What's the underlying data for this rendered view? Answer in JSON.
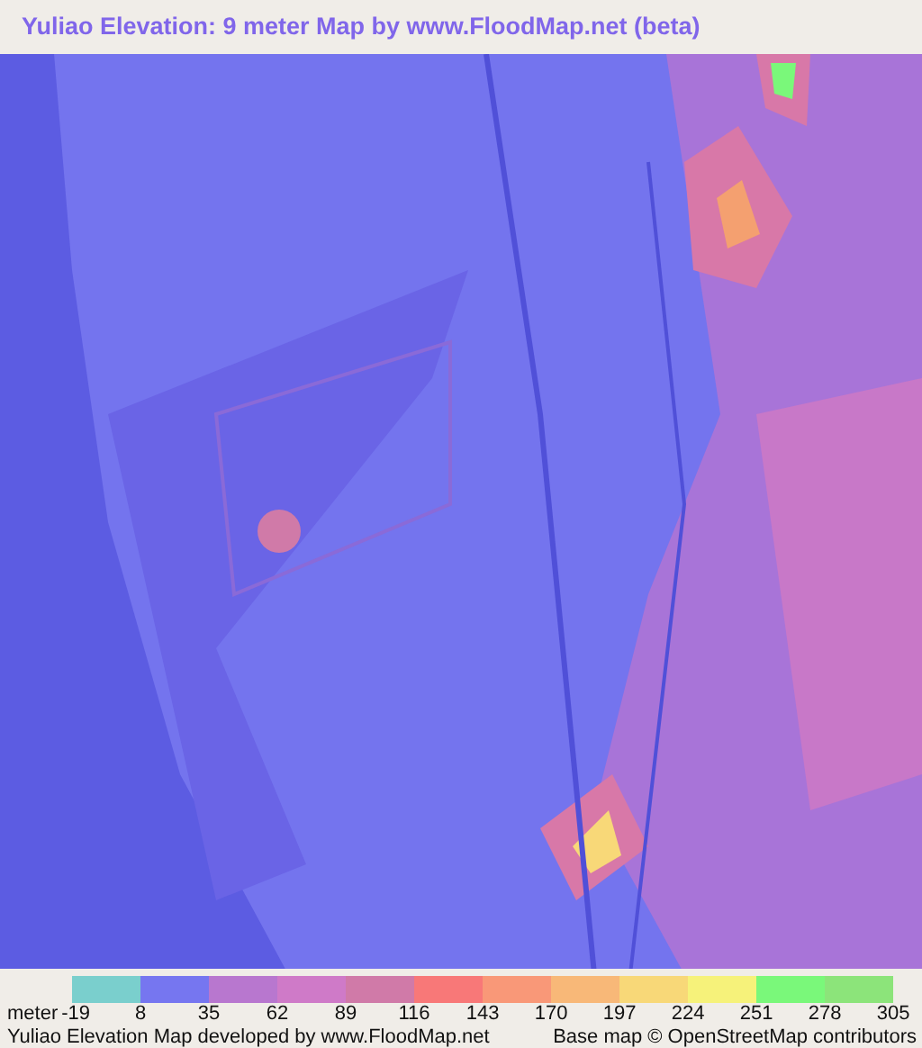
{
  "title": "Yuliao Elevation: 9 meter Map by www.FloodMap.net (beta)",
  "legend": {
    "unit": "meter",
    "swatches": [
      {
        "color": "#7acfcd"
      },
      {
        "color": "#7676f0"
      },
      {
        "color": "#b877cf"
      },
      {
        "color": "#cf7ac8"
      },
      {
        "color": "#d07aa8"
      },
      {
        "color": "#f87878"
      },
      {
        "color": "#f99878"
      },
      {
        "color": "#f8b878"
      },
      {
        "color": "#f8d878"
      },
      {
        "color": "#f6f27a"
      },
      {
        "color": "#7af87a"
      },
      {
        "color": "#8ce47a"
      }
    ],
    "ticks": [
      "-19",
      "8",
      "35",
      "62",
      "89",
      "116",
      "143",
      "170",
      "197",
      "224",
      "251",
      "278",
      "305"
    ]
  },
  "footer": {
    "credit": "Yuliao Elevation Map developed by www.FloodMap.net",
    "attribution": "Base map © OpenStreetMap contributors"
  }
}
